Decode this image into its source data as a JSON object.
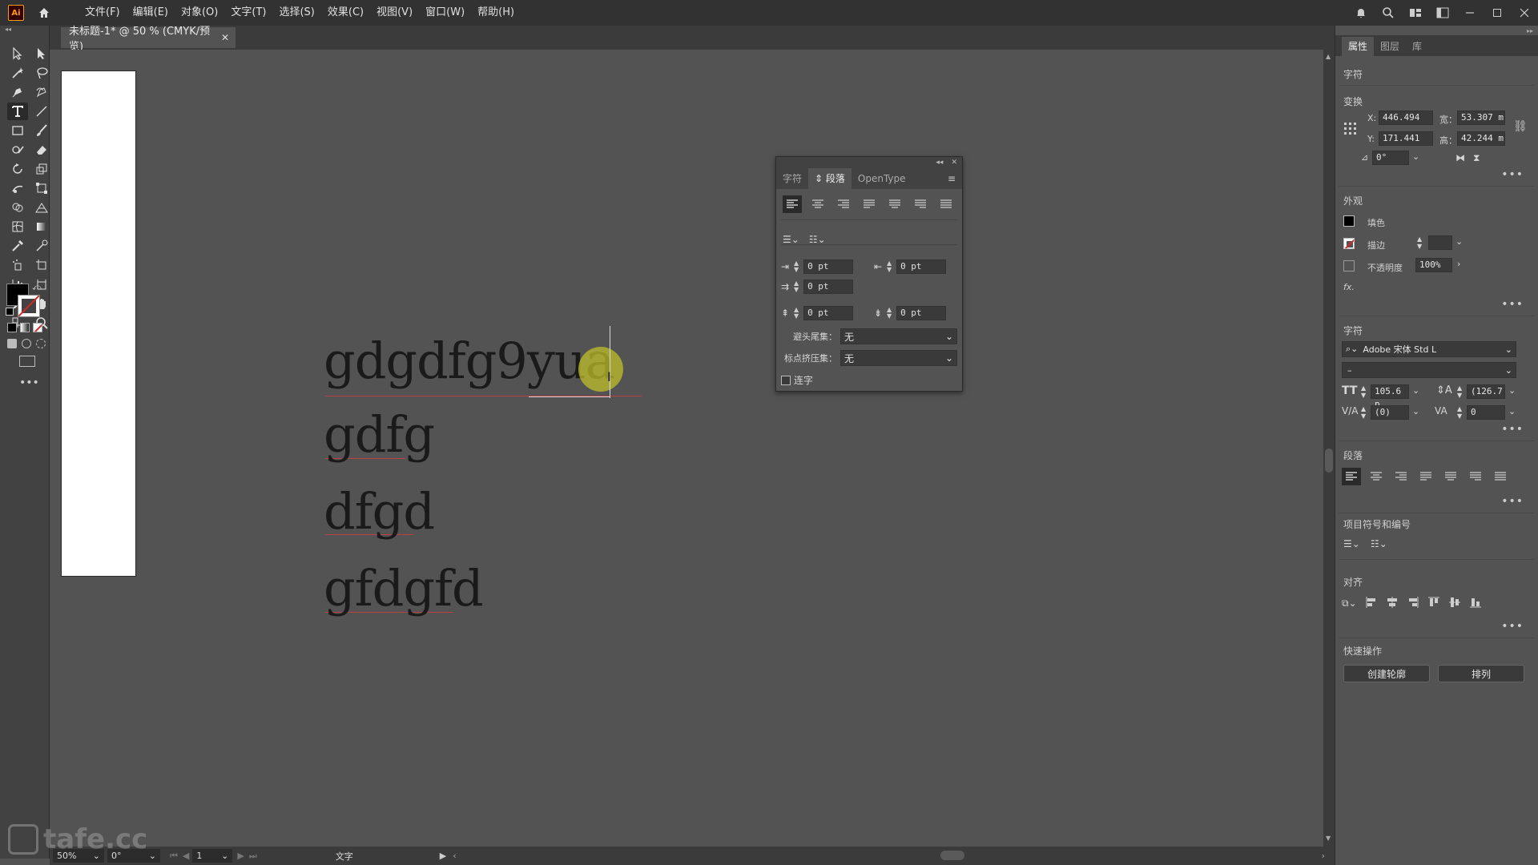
{
  "menubar": {
    "logo": "Ai",
    "menus": [
      "文件(F)",
      "编辑(E)",
      "对象(O)",
      "文字(T)",
      "选择(S)",
      "效果(C)",
      "视图(V)",
      "窗口(W)",
      "帮助(H)"
    ]
  },
  "document": {
    "tab_title": "未标题-1* @ 50 % (CMYK/预览)",
    "text_lines": [
      "gdgdfg9yua",
      "gdfg",
      "dfgd",
      "gfdgfd"
    ]
  },
  "paragraph_panel": {
    "tabs": [
      "字符",
      "段落",
      "OpenType"
    ],
    "active_tab": "段落",
    "indent_left": "0 pt",
    "indent_right": "0 pt",
    "first_line_indent": "0 pt",
    "space_before": "0 pt",
    "space_after": "0 pt",
    "kinsoku_label": "避头尾集：",
    "kinsoku_value": "无",
    "mojikumi_label": "标点挤压集：",
    "mojikumi_value": "无",
    "hyphenate_label": "连字"
  },
  "properties": {
    "tabs": [
      "属性",
      "图层",
      "库"
    ],
    "active_tab": "属性",
    "section_character_top": "字符",
    "section_transform": "变换",
    "x_label": "X:",
    "x_value": "446.494",
    "y_label": "Y:",
    "y_value": "171.441",
    "w_label": "宽：",
    "w_value": "53.307 m",
    "h_label": "高：",
    "h_value": "42.244 m",
    "angle_value": "0°",
    "section_appearance": "外观",
    "fill_label": "填色",
    "stroke_label": "描边",
    "opacity_label": "不透明度",
    "opacity_value": "100%",
    "fx_label": "fx.",
    "section_character": "字符",
    "font_family": "Adobe 宋体 Std L",
    "font_style": "–",
    "font_size": "105.6 p",
    "leading": "(126.7",
    "tracking": "(0)",
    "kerning": "0",
    "section_paragraph": "段落",
    "section_bullets": "项目符号和编号",
    "section_align": "对齐",
    "section_quick": "快速操作",
    "btn_outline": "创建轮廓",
    "btn_arrange": "排列"
  },
  "status": {
    "zoom": "50%",
    "rotate": "0°",
    "artboard": "1",
    "tool": "文字"
  },
  "watermark": "tafe.cc",
  "colors": {
    "ui_dark": "#323232",
    "panel": "#535353",
    "fill": "#000000",
    "stroke_none": "#d62828",
    "highlight": "#c4c428"
  }
}
